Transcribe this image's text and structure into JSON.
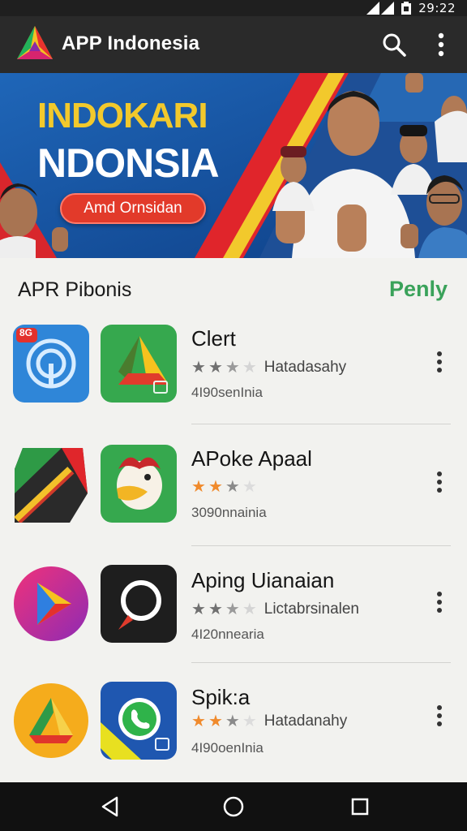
{
  "status_bar": {
    "time": "29:22"
  },
  "app_bar": {
    "title": "APP Indonesia",
    "actions": [
      "search-icon",
      "more-vert-icon"
    ]
  },
  "banner": {
    "title_line1": "INDOKARI",
    "title_line2": "NDONSIA",
    "button_label": "Amd Ornsidan"
  },
  "section": {
    "title": "APR Pibonis",
    "link_label": "Penly"
  },
  "apps": [
    {
      "name": "Clert",
      "rating": 3,
      "rating_label": "Hatadasahy",
      "meta": "4I90senInia",
      "star_color": "#707070"
    },
    {
      "name": "APoke Apaal",
      "rating": 2,
      "rating_label": "",
      "meta": "3090nnainia",
      "star_color": "#f08a2c"
    },
    {
      "name": "Aping Uianaian",
      "rating": 3,
      "rating_label": "Lictabrsinalen",
      "meta": "4I20nnearia",
      "star_color": "#707070"
    },
    {
      "name": "Spik:a",
      "rating": 3,
      "rating_label": "Hatadanahy",
      "meta": "4I90oenInia",
      "star_color": "#f08a2c"
    }
  ],
  "colors": {
    "app_bar": "#2a2a2a",
    "accent_green": "#3aa25a",
    "banner_blue": "#1d5fae",
    "banner_red": "#e23a2a",
    "banner_yellow": "#f2c92c"
  },
  "nav_bar": {
    "buttons": [
      "back-icon",
      "home-icon",
      "recents-icon"
    ]
  }
}
